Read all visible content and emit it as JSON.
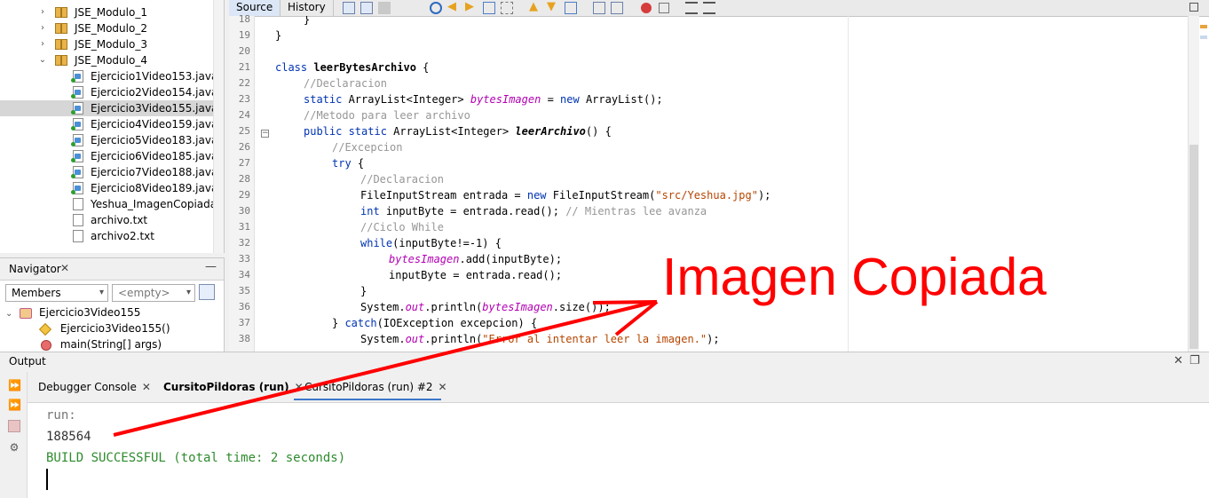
{
  "project_tree": {
    "items": [
      {
        "label": "JSE_Modulo_1",
        "type": "package",
        "expanded": false
      },
      {
        "label": "JSE_Modulo_2",
        "type": "package",
        "expanded": false
      },
      {
        "label": "JSE_Modulo_3",
        "type": "package",
        "expanded": false
      },
      {
        "label": "JSE_Modulo_4",
        "type": "package",
        "expanded": true
      },
      {
        "label": "Ejercicio1Video153.java",
        "type": "java"
      },
      {
        "label": "Ejercicio2Video154.java",
        "type": "java"
      },
      {
        "label": "Ejercicio3Video155.java",
        "type": "java",
        "selected": true
      },
      {
        "label": "Ejercicio4Video159.java",
        "type": "java"
      },
      {
        "label": "Ejercicio5Video183.java",
        "type": "java"
      },
      {
        "label": "Ejercicio6Video185.java",
        "type": "java"
      },
      {
        "label": "Ejercicio7Video188.java",
        "type": "java"
      },
      {
        "label": "Ejercicio8Video189.java",
        "type": "java"
      },
      {
        "label": "Yeshua_ImagenCopiada.jp",
        "type": "file"
      },
      {
        "label": "archivo.txt",
        "type": "file"
      },
      {
        "label": "archivo2.txt",
        "type": "file"
      }
    ]
  },
  "navigator": {
    "title": "Navigator",
    "close": "✕",
    "minimize": "—",
    "filter_label": "Members",
    "scope_label": "<empty>",
    "members": {
      "class_name": "Ejercicio3Video155",
      "constructor": "Ejercicio3Video155()",
      "method": "main(String[] args)"
    }
  },
  "editor": {
    "tabs": {
      "source": "Source",
      "history": "History"
    },
    "line_numbers": [
      "18",
      "19",
      "20",
      "21",
      "22",
      "23",
      "24",
      "25",
      "26",
      "27",
      "28",
      "29",
      "30",
      "31",
      "32",
      "33",
      "34",
      "35",
      "36",
      "37",
      "38"
    ],
    "code": {
      "l18": "}",
      "l19": "}",
      "l21_kw": "class",
      "l21_name": "leerBytesArchivo",
      "l21_end": " {",
      "l22": "//Declaracion",
      "l23_kw": "static",
      "l23_type": " ArrayList<Integer> ",
      "l23_field": "bytesImagen",
      "l23_mid": " = ",
      "l23_new": "new",
      "l23_end": " ArrayList();",
      "l24": "//Metodo para leer archivo",
      "l25_kw": "public static",
      "l25_type": " ArrayList<Integer> ",
      "l25_method": "leerArchivo",
      "l25_end": "() {",
      "l26": "//Excepcion",
      "l27_kw": "try",
      "l27_end": " {",
      "l28": "//Declaracion",
      "l29_start": "FileInputStream entrada = ",
      "l29_new": "new",
      "l29_mid": " FileInputStream(",
      "l29_str": "\"src/Yeshua.jpg\"",
      "l29_end": ");",
      "l30_kw": "int",
      "l30_mid": " inputByte = entrada.read(); ",
      "l30_cm": "// Mientras lee avanza",
      "l31": "//Ciclo While",
      "l32_kw": "while",
      "l32_end": "(inputByte!=-1) {",
      "l33_field": "bytesImagen",
      "l33_end": ".add(inputByte);",
      "l34": "inputByte = entrada.read();",
      "l35": "}",
      "l36_start": "System.",
      "l36_out": "out",
      "l36_mid": ".println(",
      "l36_field": "bytesImagen",
      "l36_end": ".size());",
      "l37_start": "} ",
      "l37_kw": "catch",
      "l37_end": "(IOException excepcion) {",
      "l38_start": "System.",
      "l38_out": "out",
      "l38_mid": ".println(",
      "l38_str": "\"Error al intentar leer la imagen.\"",
      "l38_end": ");"
    }
  },
  "output": {
    "title": "Output",
    "tabs": [
      {
        "label": "Debugger Console",
        "close": "✕"
      },
      {
        "label": "CursitoPildoras (run)",
        "close": "✕"
      },
      {
        "label": "CursitoPildoras (run) #2",
        "close": "✕"
      }
    ],
    "lines": {
      "run": "run:",
      "value": "188564",
      "build": "BUILD SUCCESSFUL (total time: 2 seconds)"
    }
  },
  "annotation": {
    "text": "Imagen Copiada",
    "color": "#ff0000"
  },
  "colors": {
    "keyword": "#0033b3",
    "comment": "#969696",
    "string": "#b54500",
    "field": "#b200b2",
    "build_success": "#2e8b2e"
  }
}
